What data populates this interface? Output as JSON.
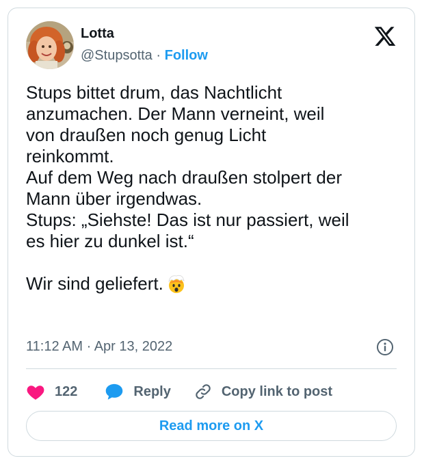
{
  "author": {
    "name": "Lotta",
    "handle": "@Stupsotta",
    "separator": "·",
    "follow_label": "Follow"
  },
  "tweet": {
    "text": "Stups bittet drum, das Nachtlicht\nanzumachen. Der Mann verneint, weil\nvon draußen noch genug Licht\nreinkommt.\nAuf dem Weg nach draußen stolpert der\nMann über irgendwas.\nStups: „Siehste! Das ist nur passiert, weil\nes hier zu dunkel ist.“\n\nWir sind geliefert.",
    "emoji": "exploding-head-emoji",
    "timestamp": "11:12 AM · Apr 13, 2022"
  },
  "actions": {
    "like_count": "122",
    "reply_label": "Reply",
    "copy_link_label": "Copy link to post"
  },
  "read_more_label": "Read more on X",
  "colors": {
    "accent": "#1d9bf0",
    "like": "#f91880",
    "text": "#0f1419",
    "muted": "#536471",
    "border": "#cfd9de"
  }
}
